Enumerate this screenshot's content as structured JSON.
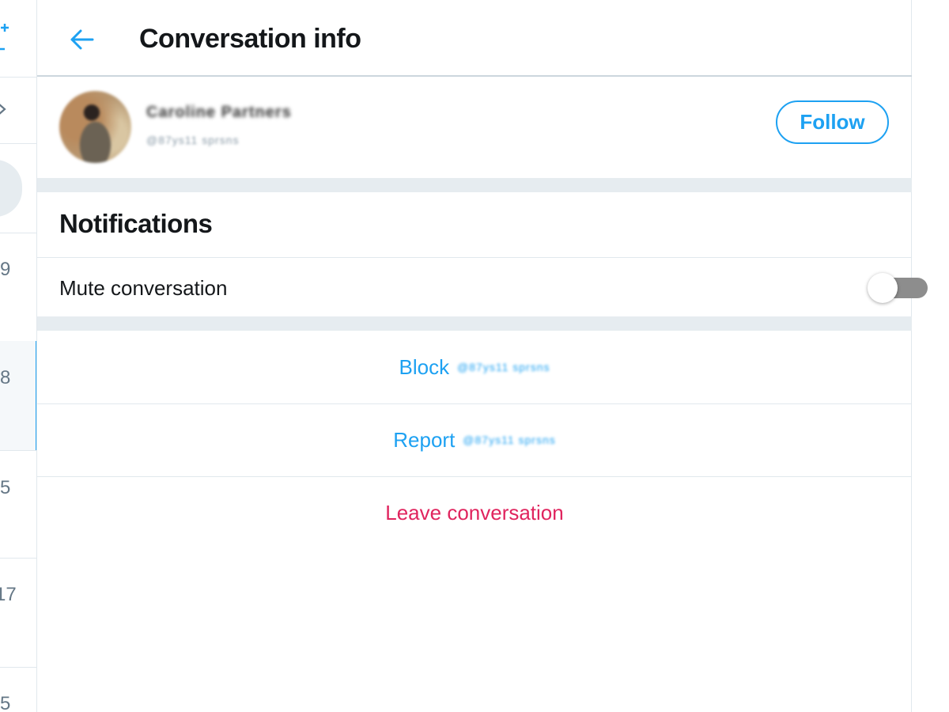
{
  "left_strip": {
    "items": [
      {
        "number": "9"
      },
      {
        "number": "8",
        "selected": true
      },
      {
        "number": "5"
      },
      {
        "number": "17"
      },
      {
        "number": "5"
      }
    ]
  },
  "header": {
    "title": "Conversation info",
    "back_icon": "arrow-left-icon"
  },
  "user": {
    "display_name": "Caroline Partners",
    "handle": "@87ys11 sprsns",
    "follow_label": "Follow"
  },
  "notifications": {
    "heading": "Notifications",
    "mute_label": "Mute conversation",
    "mute_enabled": false
  },
  "actions": {
    "block_label": "Block",
    "block_handle": "@87ys11 sprsns",
    "report_label": "Report",
    "report_handle": "@87ys11 sprsns",
    "leave_label": "Leave conversation"
  },
  "colors": {
    "accent": "#1da1f2",
    "danger": "#e0245e",
    "divider": "#e6ecf0",
    "toggle_off": "#8d8d8d"
  }
}
